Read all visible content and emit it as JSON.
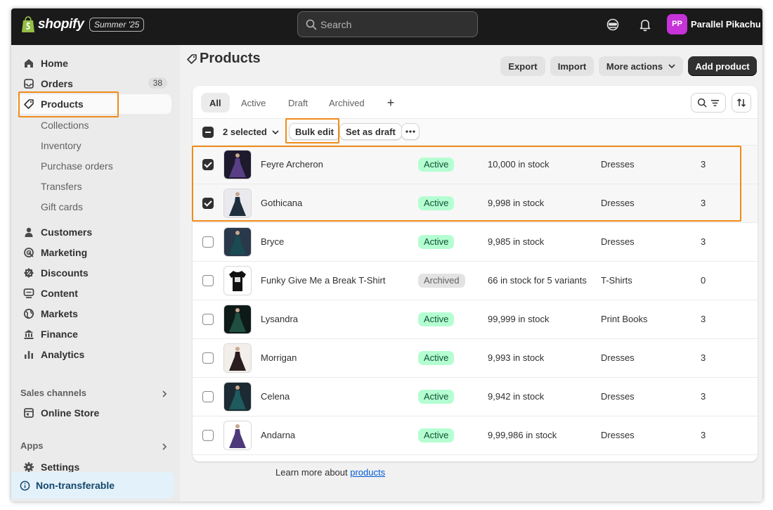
{
  "topbar": {
    "logo_text": "shopify",
    "edition_badge": "Summer '25",
    "search_placeholder": "Search",
    "avatar_initials": "PP",
    "store_name": "Parallel Pikachu"
  },
  "sidebar": {
    "items": [
      {
        "label": "Home",
        "icon": "home-icon"
      },
      {
        "label": "Orders",
        "icon": "inbox-icon",
        "badge": "38"
      },
      {
        "label": "Products",
        "icon": "tag-icon"
      }
    ],
    "product_subitems": [
      "Collections",
      "Inventory",
      "Purchase orders",
      "Transfers",
      "Gift cards"
    ],
    "items2": [
      {
        "label": "Customers",
        "icon": "person-icon"
      },
      {
        "label": "Marketing",
        "icon": "target-icon"
      },
      {
        "label": "Discounts",
        "icon": "discount-icon"
      },
      {
        "label": "Content",
        "icon": "content-icon"
      },
      {
        "label": "Markets",
        "icon": "globe-icon"
      },
      {
        "label": "Finance",
        "icon": "bank-icon"
      },
      {
        "label": "Analytics",
        "icon": "bar-chart-icon"
      }
    ],
    "sales_channels_title": "Sales channels",
    "online_store": "Online Store",
    "apps_title": "Apps",
    "settings": "Settings",
    "nontransferable": "Non-transferable"
  },
  "page": {
    "title": "Products",
    "export": "Export",
    "import": "Import",
    "more_actions": "More actions",
    "add_product": "Add product"
  },
  "tabs": [
    "All",
    "Active",
    "Draft",
    "Archived"
  ],
  "bulk": {
    "selected_count": "2 selected",
    "bulk_edit": "Bulk edit",
    "set_as_draft": "Set as draft"
  },
  "products": [
    {
      "name": "Feyre Archeron",
      "status": "Active",
      "inventory": "10,000 in stock",
      "type": "Dresses",
      "count": "3",
      "selected": true
    },
    {
      "name": "Gothicana",
      "status": "Active",
      "inventory": "9,998 in stock",
      "type": "Dresses",
      "count": "3",
      "selected": true
    },
    {
      "name": "Bryce",
      "status": "Active",
      "inventory": "9,985 in stock",
      "type": "Dresses",
      "count": "3",
      "selected": false
    },
    {
      "name": "Funky Give Me a Break T-Shirt",
      "status": "Archived",
      "inventory": "66 in stock for 5 variants",
      "type": "T-Shirts",
      "count": "0",
      "selected": false
    },
    {
      "name": "Lysandra",
      "status": "Active",
      "inventory": "99,999 in stock",
      "type": "Print Books",
      "count": "3",
      "selected": false
    },
    {
      "name": "Morrigan",
      "status": "Active",
      "inventory": "9,993 in stock",
      "type": "Dresses",
      "count": "3",
      "selected": false
    },
    {
      "name": "Celena",
      "status": "Active",
      "inventory": "9,942 in stock",
      "type": "Dresses",
      "count": "3",
      "selected": false
    },
    {
      "name": "Andarna",
      "status": "Active",
      "inventory": "9,99,986 in stock",
      "type": "Dresses",
      "count": "3",
      "selected": false
    }
  ],
  "footer": {
    "learn_prefix": "Learn more about ",
    "learn_link": "products"
  },
  "colors": {
    "topbar_bg": "#1a1a1a",
    "active_badge_bg": "#b4fed2",
    "highlight": "#f08c1a",
    "primary_button": "#303030",
    "avatar_bg": "#c633d8"
  }
}
